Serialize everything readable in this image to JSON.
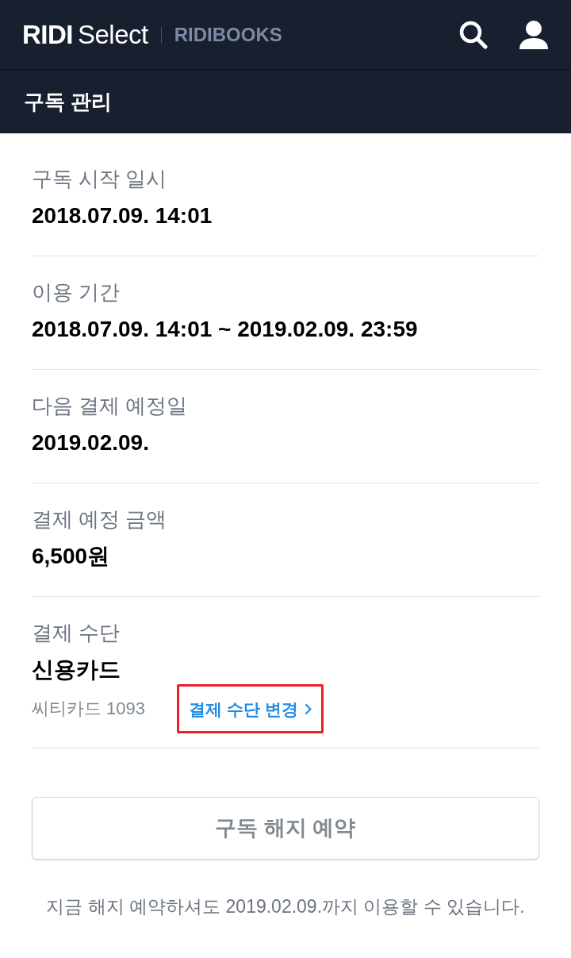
{
  "header": {
    "logo": {
      "brand": "RIDI",
      "product": "Select"
    },
    "store_link": "RIDIBOOKS"
  },
  "subheader": {
    "title": "구독 관리"
  },
  "sections": [
    {
      "label": "구독 시작 일시",
      "value": "2018.07.09. 14:01"
    },
    {
      "label": "이용 기간",
      "value": "2018.07.09. 14:01 ~ 2019.02.09. 23:59"
    },
    {
      "label": "다음 결제 예정일",
      "value": "2019.02.09."
    },
    {
      "label": "결제 예정 금액",
      "value": "6,500원"
    },
    {
      "label": "결제 수단",
      "value": "신용카드",
      "detail": "씨티카드 1093",
      "action": {
        "label": "결제 수단 변경",
        "highlighted": true
      }
    }
  ],
  "cancel_button": {
    "label": "구독 해지 예약"
  },
  "notice": "지금 해지 예약하셔도 2019.02.09.까지 이용할 수 있습니다."
}
